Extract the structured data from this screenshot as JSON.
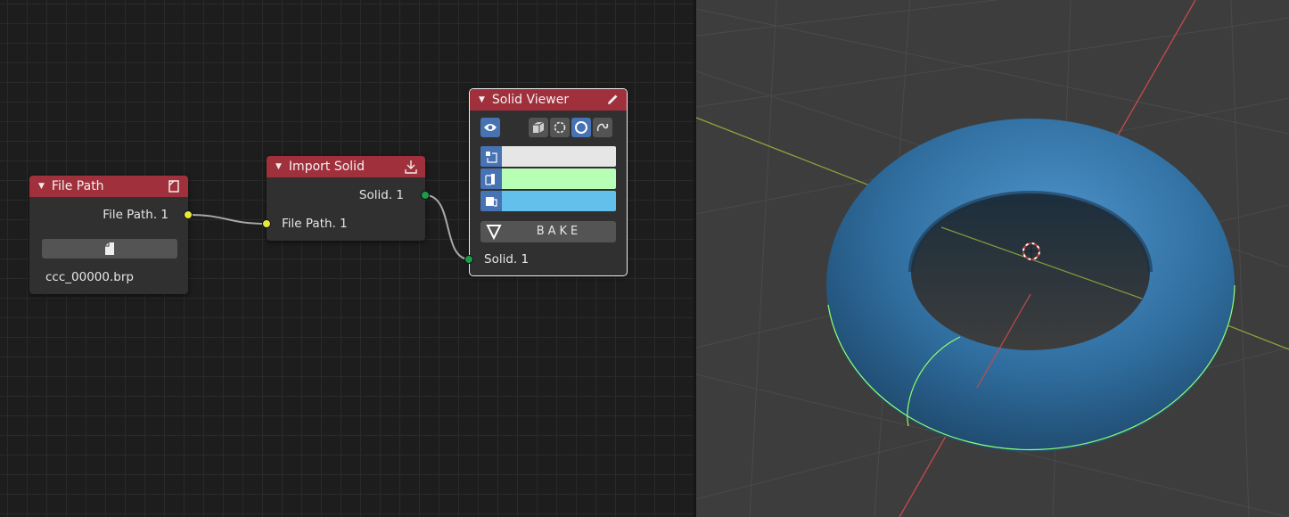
{
  "nodes": {
    "file_path": {
      "title": "File Path",
      "output_label": "File Path. 1",
      "file_name": "ccc_00000.brp"
    },
    "import_solid": {
      "title": "Import Solid",
      "output_label": "Solid. 1",
      "input_label": "File Path. 1"
    },
    "solid_viewer": {
      "title": "Solid Viewer",
      "input_label": "Solid. 1",
      "bake_label": "BAKE",
      "colors": {
        "vertices": "#e6e6e6",
        "edges": "#b8ffb6",
        "faces": "#62c0ea"
      }
    }
  },
  "icons": {
    "file_path_header": "file-icon",
    "file_button": "file-icon",
    "import_header": "import-icon",
    "viewer_header": "pencil-icon",
    "visibility": "eye-icon",
    "display_modes": [
      "cube-icon",
      "wire-ring-icon",
      "sphere-ring-icon",
      "curve-icon"
    ],
    "bake": "triangle-down-icon"
  },
  "colors": {
    "node_header": "#a0303c",
    "path_socket": "#e8e83a",
    "solid_socket": "#1e9a4a",
    "active_toggle": "#4772b3",
    "torus": "#3a7bb0",
    "torus_edges": "#8eff6a",
    "x_axis": "#c84a4a",
    "y_axis": "#8aa23a"
  }
}
